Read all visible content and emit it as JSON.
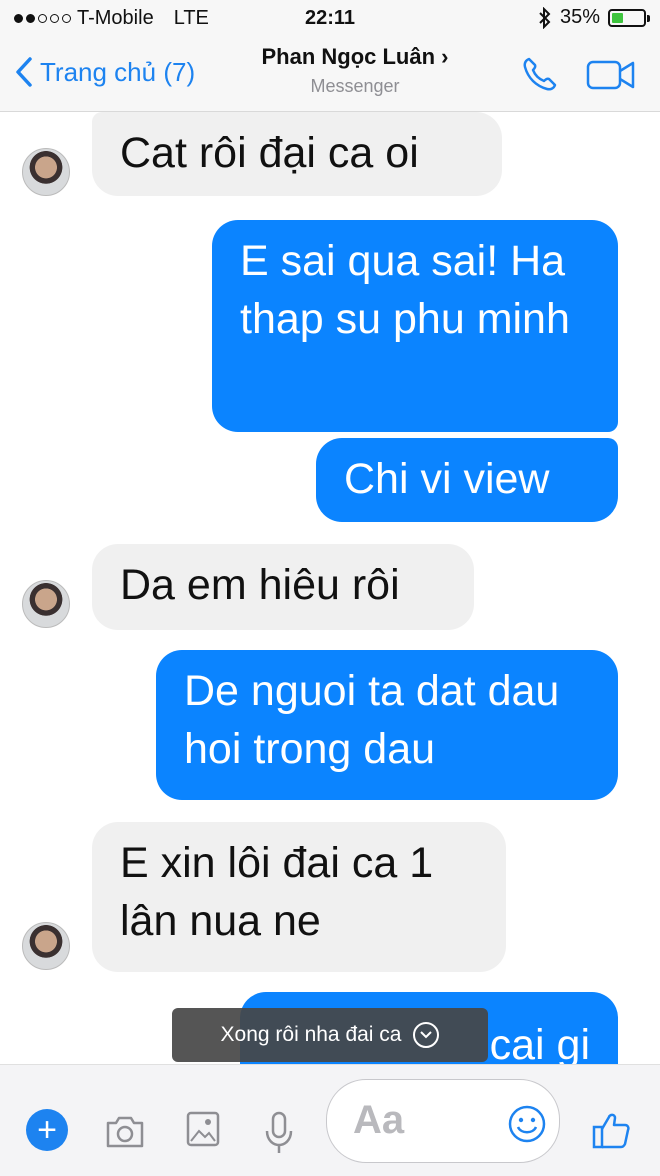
{
  "status": {
    "carrier": "T-Mobile",
    "network": "LTE",
    "time": "22:11",
    "battery": "35%",
    "battery_level": 0.35,
    "signal_bars_filled": 2,
    "signal_bars_total": 5
  },
  "nav": {
    "back_label": "Trang chủ (7)",
    "title": "Phan Ngọc Luân",
    "title_chevron": "›",
    "subtitle": "Messenger"
  },
  "colors": {
    "accent": "#1d83f0",
    "outgoing_bubble": "#0b84ff",
    "incoming_bubble": "#f0f0f0"
  },
  "messages": [
    {
      "direction": "in",
      "text": "Cat rôi đại ca oi"
    },
    {
      "direction": "out",
      "text": "E sai qua sai! Ha thap su phu minh"
    },
    {
      "direction": "out",
      "text": "Chi vi view"
    },
    {
      "direction": "in",
      "text": "Da em hiêu rôi"
    },
    {
      "direction": "out",
      "text": "De nguoi ta dat dau hoi trong dau"
    },
    {
      "direction": "in",
      "text": "E xin lôi đai ca 1 lân nua ne"
    },
    {
      "direction": "out",
      "text": "cai gi"
    }
  ],
  "toast": {
    "text": "Xong rôi nha đai ca",
    "icon": "chevron-down-circle-icon"
  },
  "composer": {
    "placeholder": "Aa",
    "icons": [
      "plus-icon",
      "camera-icon",
      "image-icon",
      "microphone-icon",
      "emoji-icon",
      "thumbs-up-icon"
    ]
  }
}
